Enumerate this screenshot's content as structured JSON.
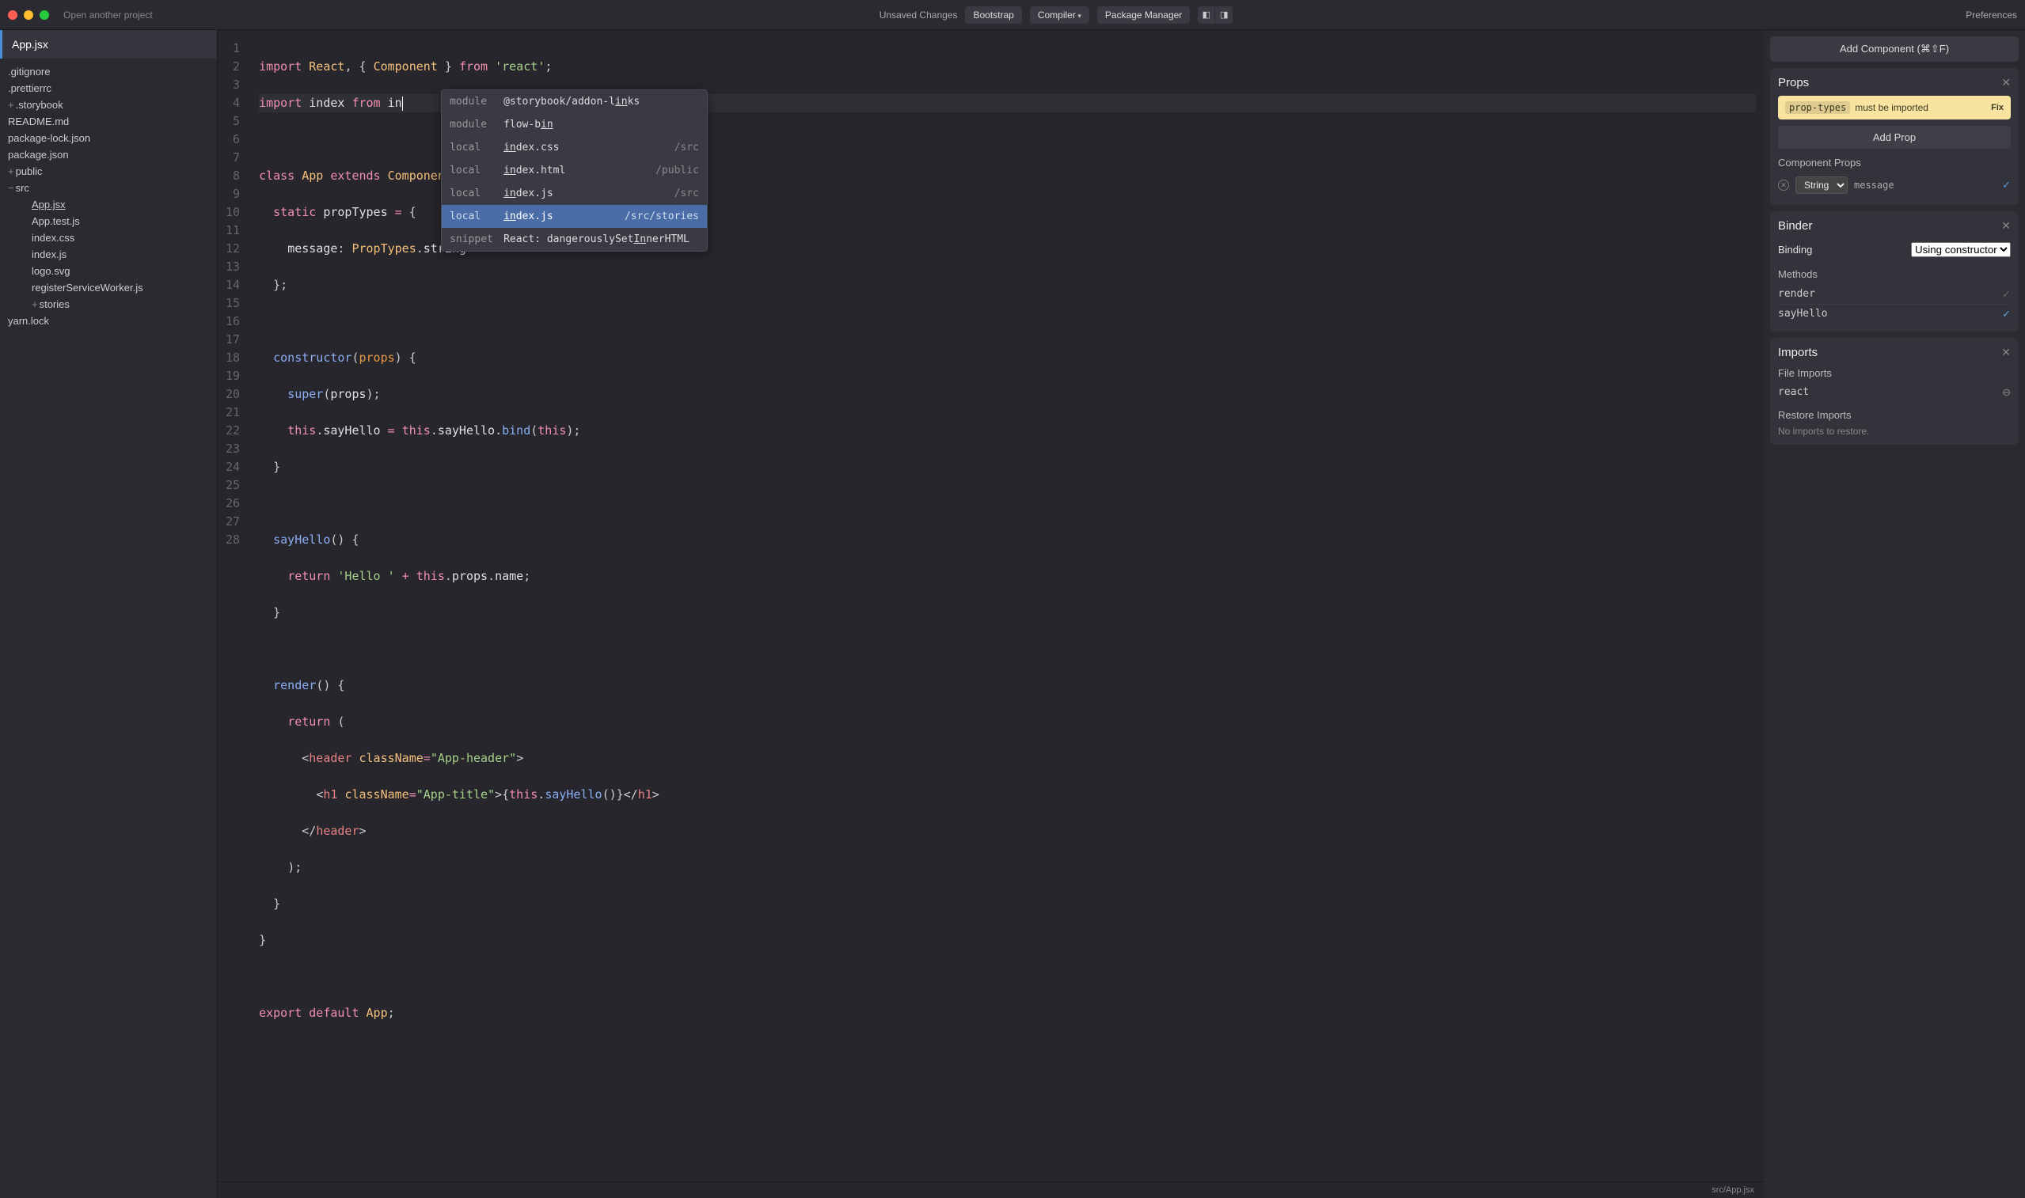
{
  "topbar": {
    "open_project": "Open another project",
    "unsaved": "Unsaved Changes",
    "bootstrap": "Bootstrap",
    "compiler": "Compiler",
    "package_manager": "Package Manager",
    "preferences": "Preferences"
  },
  "sidebar": {
    "active_tab": "App.jsx",
    "tree": [
      {
        "label": ".gitignore",
        "indent": 0
      },
      {
        "label": ".prettierrc",
        "indent": 0
      },
      {
        "label": ".storybook",
        "indent": 0,
        "prefix": "plus"
      },
      {
        "label": "README.md",
        "indent": 0
      },
      {
        "label": "package-lock.json",
        "indent": 0
      },
      {
        "label": "package.json",
        "indent": 0
      },
      {
        "label": "public",
        "indent": 0,
        "prefix": "plus"
      },
      {
        "label": "src",
        "indent": 0,
        "prefix": "minus"
      },
      {
        "label": "App.jsx",
        "indent": 1,
        "current": true
      },
      {
        "label": "App.test.js",
        "indent": 1
      },
      {
        "label": "index.css",
        "indent": 1
      },
      {
        "label": "index.js",
        "indent": 1
      },
      {
        "label": "logo.svg",
        "indent": 1
      },
      {
        "label": "registerServiceWorker.js",
        "indent": 1
      },
      {
        "label": "stories",
        "indent": 1,
        "prefix": "plus"
      },
      {
        "label": "yarn.lock",
        "indent": 0
      }
    ]
  },
  "editor": {
    "lines": 28,
    "status_path": "src/App.jsx"
  },
  "autocomplete": {
    "items": [
      {
        "kind": "module",
        "name": "@storybook/addon-links",
        "match": "in",
        "path": ""
      },
      {
        "kind": "module",
        "name": "flow-bin",
        "match": "in",
        "path": ""
      },
      {
        "kind": "local",
        "name": "index.css",
        "match": "in",
        "path": "/src"
      },
      {
        "kind": "local",
        "name": "index.html",
        "match": "in",
        "path": "/public"
      },
      {
        "kind": "local",
        "name": "index.js",
        "match": "in",
        "path": "/src"
      },
      {
        "kind": "local",
        "name": "index.js",
        "match": "in",
        "path": "/src/stories",
        "selected": true
      },
      {
        "kind": "snippet",
        "name": "React: dangerouslySetInnerHTML",
        "match": "In",
        "path": ""
      }
    ]
  },
  "right": {
    "add_component": "Add Component (⌘⇧F)",
    "props": {
      "title": "Props",
      "warning_chip": "prop-types",
      "warning_text": "must be imported",
      "warning_fix": "Fix",
      "add_prop": "Add Prop",
      "component_props_head": "Component Props",
      "prop_type": "String",
      "prop_name": "message"
    },
    "binder": {
      "title": "Binder",
      "binding_label": "Binding",
      "binding_value": "Using constructor",
      "methods_head": "Methods",
      "methods": [
        {
          "name": "render",
          "checked": false
        },
        {
          "name": "sayHello",
          "checked": true
        }
      ]
    },
    "imports": {
      "title": "Imports",
      "file_imports_head": "File Imports",
      "items": [
        "react"
      ],
      "restore_head": "Restore Imports",
      "restore_msg": "No imports to restore."
    }
  }
}
